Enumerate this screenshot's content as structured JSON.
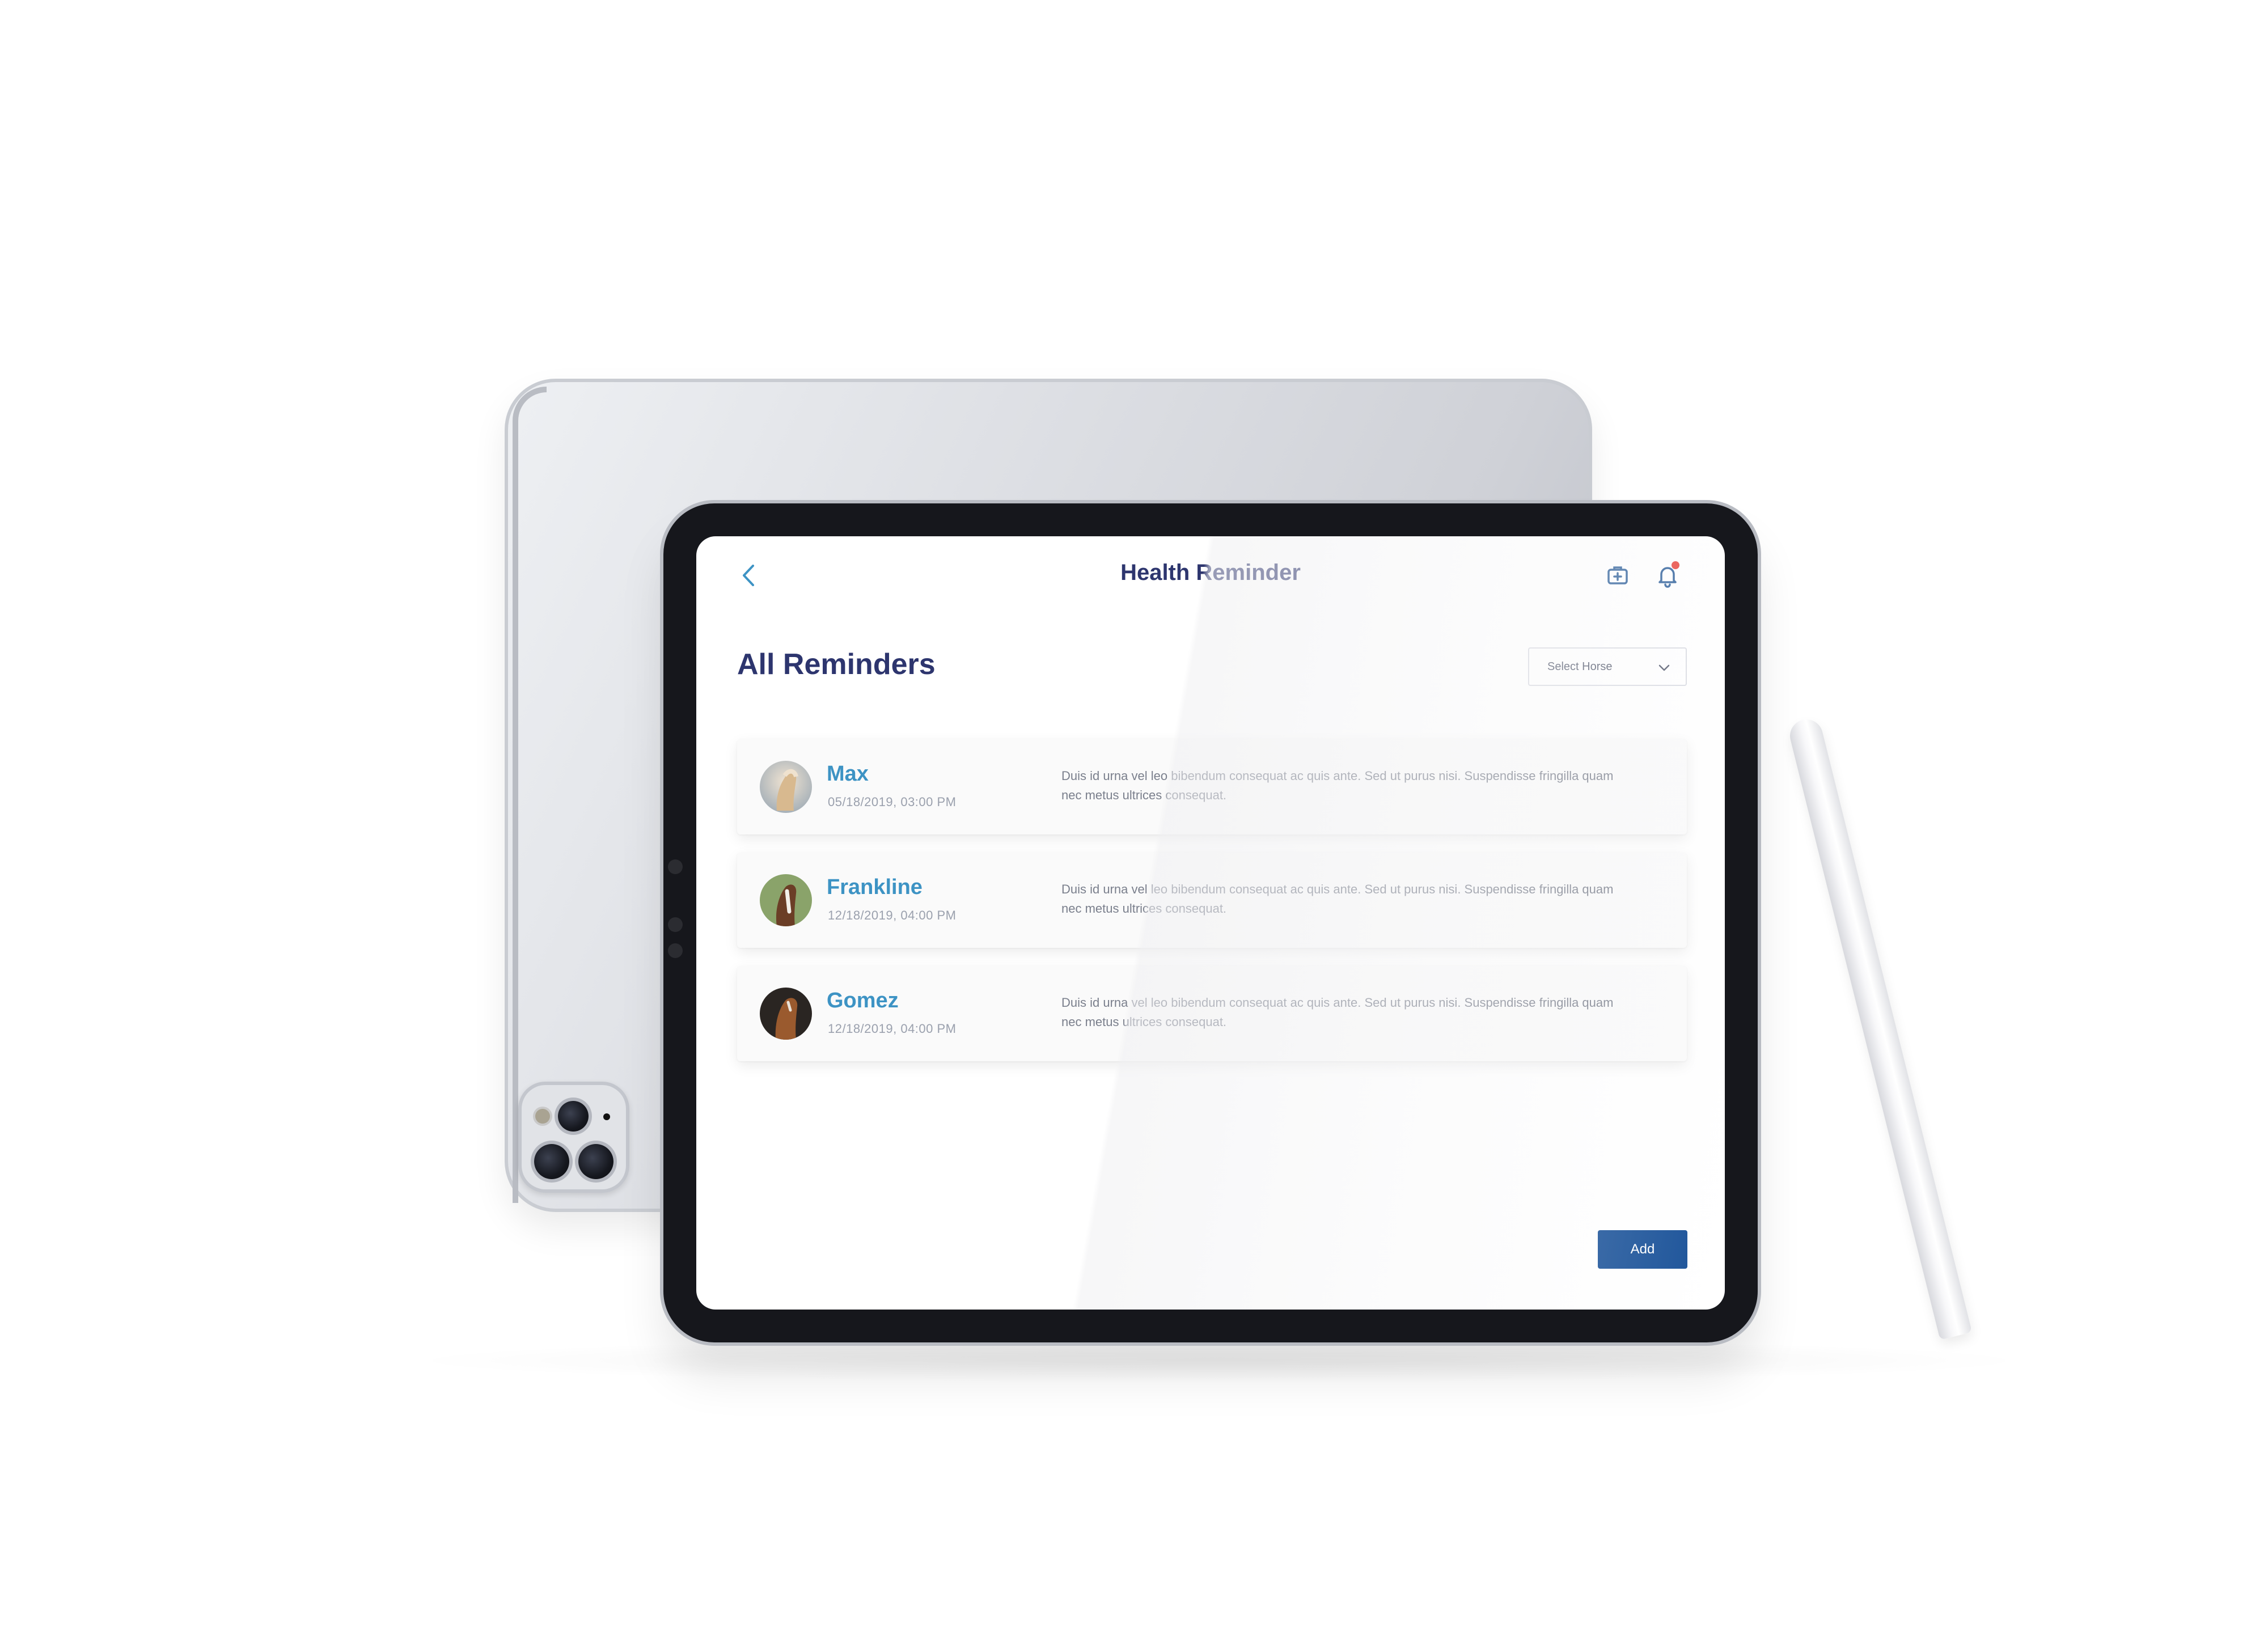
{
  "app": {
    "title": "Health Reminder"
  },
  "header": {
    "back_icon": "chevron-left-icon",
    "actions": [
      {
        "icon": "first-aid-kit-icon"
      },
      {
        "icon": "bell-icon",
        "has_notification": true
      }
    ]
  },
  "main": {
    "section_title": "All Reminders",
    "horse_select": {
      "selected_label": "Select Horse",
      "icon": "chevron-down-icon"
    },
    "reminders": [
      {
        "name": "Max",
        "datetime": "05/18/2019, 03:00 PM",
        "note": "Duis id urna vel leo bibendum consequat ac quis ante. Sed ut purus nisi. Suspendisse fringilla quam nec metus ultrices consequat."
      },
      {
        "name": "Frankline",
        "datetime": "12/18/2019, 04:00 PM",
        "note": "Duis id urna vel leo bibendum consequat ac quis ante. Sed ut purus nisi. Suspendisse fringilla quam nec metus ultrices consequat."
      },
      {
        "name": "Gomez",
        "datetime": "12/18/2019, 04:00 PM",
        "note": "Duis id urna vel leo bibendum consequat ac quis ante. Sed ut purus nisi. Suspendisse fringilla quam nec metus ultrices consequat."
      }
    ],
    "add_button_label": "Add"
  },
  "colors": {
    "title": "#2d356e",
    "accent": "#3d93c4",
    "primary_button": "#164f97",
    "notification": "#e8423a"
  }
}
